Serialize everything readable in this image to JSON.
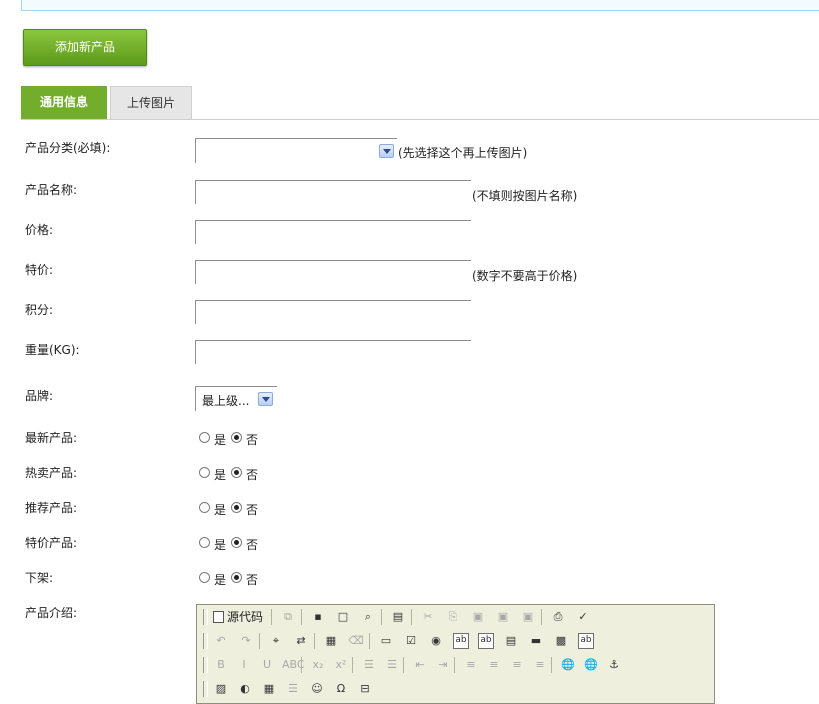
{
  "add_button": "添加新产品",
  "tabs": [
    {
      "label": "通用信息",
      "active": true
    },
    {
      "label": "上传图片",
      "active": false
    }
  ],
  "form": {
    "category": {
      "label": "产品分类(必填):",
      "value": "",
      "hint": "(先选择这个再上传图片)"
    },
    "name": {
      "label": "产品名称:",
      "value": "",
      "hint": "(不填则按图片名称)"
    },
    "price": {
      "label": "价格:",
      "value": ""
    },
    "special_price": {
      "label": "特价:",
      "value": "",
      "hint": "(数字不要高于价格)"
    },
    "points": {
      "label": "积分:",
      "value": ""
    },
    "weight": {
      "label": "重量(KG):",
      "value": ""
    },
    "brand": {
      "label": "品牌:",
      "value": "最上级..."
    },
    "yes_label": "是",
    "no_label": "否",
    "radios": [
      {
        "label": "最新产品:",
        "selected": "否"
      },
      {
        "label": "热卖产品:",
        "selected": "否"
      },
      {
        "label": "推荐产品:",
        "selected": "否"
      },
      {
        "label": "特价产品:",
        "selected": "否"
      },
      {
        "label": "下架:",
        "selected": "否"
      }
    ],
    "description": {
      "label": "产品介绍:"
    }
  },
  "editor": {
    "source_label": "源代码",
    "row1": [
      {
        "name": "source-button"
      },
      {
        "name": "template-icon",
        "glyph": "⧉",
        "dim": true
      },
      {
        "name": "save-icon",
        "glyph": "▪"
      },
      {
        "name": "new-page-icon",
        "glyph": "□"
      },
      {
        "name": "preview-icon",
        "glyph": "⌕"
      },
      {
        "name": "templates-icon",
        "glyph": "▤"
      },
      {
        "name": "cut-icon",
        "glyph": "✂",
        "dim": true
      },
      {
        "name": "copy-icon",
        "glyph": "⎘",
        "dim": true
      },
      {
        "name": "paste-icon",
        "glyph": "▣",
        "dim": true
      },
      {
        "name": "paste-text-icon",
        "glyph": "▣",
        "dim": true
      },
      {
        "name": "paste-word-icon",
        "glyph": "▣",
        "dim": true
      },
      {
        "name": "print-icon",
        "glyph": "⎙"
      },
      {
        "name": "spellcheck-icon",
        "glyph": "✓"
      }
    ],
    "row2": [
      {
        "name": "undo-icon",
        "glyph": "↶",
        "dim": true
      },
      {
        "name": "redo-icon",
        "glyph": "↷",
        "dim": true
      },
      {
        "name": "find-icon",
        "glyph": "⌖"
      },
      {
        "name": "replace-icon",
        "glyph": "⇄"
      },
      {
        "name": "select-all-icon",
        "glyph": "▦"
      },
      {
        "name": "remove-format-icon",
        "glyph": "⌫",
        "dim": true
      },
      {
        "name": "form-icon",
        "glyph": "▭"
      },
      {
        "name": "checkbox-icon",
        "glyph": "☑"
      },
      {
        "name": "radio-icon",
        "glyph": "◉"
      },
      {
        "name": "textfield-icon",
        "glyph": "ab",
        "box": true
      },
      {
        "name": "textarea-icon",
        "glyph": "ab",
        "box": true
      },
      {
        "name": "select-field-icon",
        "glyph": "▤"
      },
      {
        "name": "button-field-icon",
        "glyph": "▬"
      },
      {
        "name": "image-button-icon",
        "glyph": "▩"
      },
      {
        "name": "hidden-field-icon",
        "glyph": "ab",
        "box": true
      }
    ],
    "row3": [
      {
        "name": "bold-icon",
        "glyph": "B",
        "dim": true
      },
      {
        "name": "italic-icon",
        "glyph": "I",
        "dim": true
      },
      {
        "name": "underline-icon",
        "glyph": "U",
        "dim": true
      },
      {
        "name": "strike-icon",
        "glyph": "ABC",
        "dim": true
      },
      {
        "name": "subscript-icon",
        "glyph": "x₂",
        "dim": true
      },
      {
        "name": "superscript-icon",
        "glyph": "x²",
        "dim": true
      },
      {
        "name": "ordered-list-icon",
        "glyph": "☰",
        "dim": true
      },
      {
        "name": "unordered-list-icon",
        "glyph": "☰",
        "dim": true
      },
      {
        "name": "outdent-icon",
        "glyph": "⇤",
        "dim": true
      },
      {
        "name": "indent-icon",
        "glyph": "⇥",
        "dim": true
      },
      {
        "name": "align-left-icon",
        "glyph": "≡",
        "dim": true
      },
      {
        "name": "align-center-icon",
        "glyph": "≡",
        "dim": true
      },
      {
        "name": "align-right-icon",
        "glyph": "≡",
        "dim": true
      },
      {
        "name": "justify-icon",
        "glyph": "≡",
        "dim": true
      },
      {
        "name": "link-icon",
        "glyph": "🌐"
      },
      {
        "name": "unlink-icon",
        "glyph": "🌐",
        "dim": true
      },
      {
        "name": "anchor-icon",
        "glyph": "⚓"
      }
    ],
    "row4": [
      {
        "name": "image-icon",
        "glyph": "▨"
      },
      {
        "name": "flash-icon",
        "glyph": "◐"
      },
      {
        "name": "table-icon",
        "glyph": "▦"
      },
      {
        "name": "horizontal-rule-icon",
        "glyph": "☰",
        "dim": true
      },
      {
        "name": "smiley-icon",
        "glyph": "☺"
      },
      {
        "name": "special-char-icon",
        "glyph": "Ω"
      },
      {
        "name": "page-break-icon",
        "glyph": "⊟"
      }
    ]
  },
  "colors": {
    "accent_green": "#72ae2c",
    "button_green": "#6fac2a",
    "info_border": "#9fd8f0",
    "editor_bg": "#efefde"
  }
}
